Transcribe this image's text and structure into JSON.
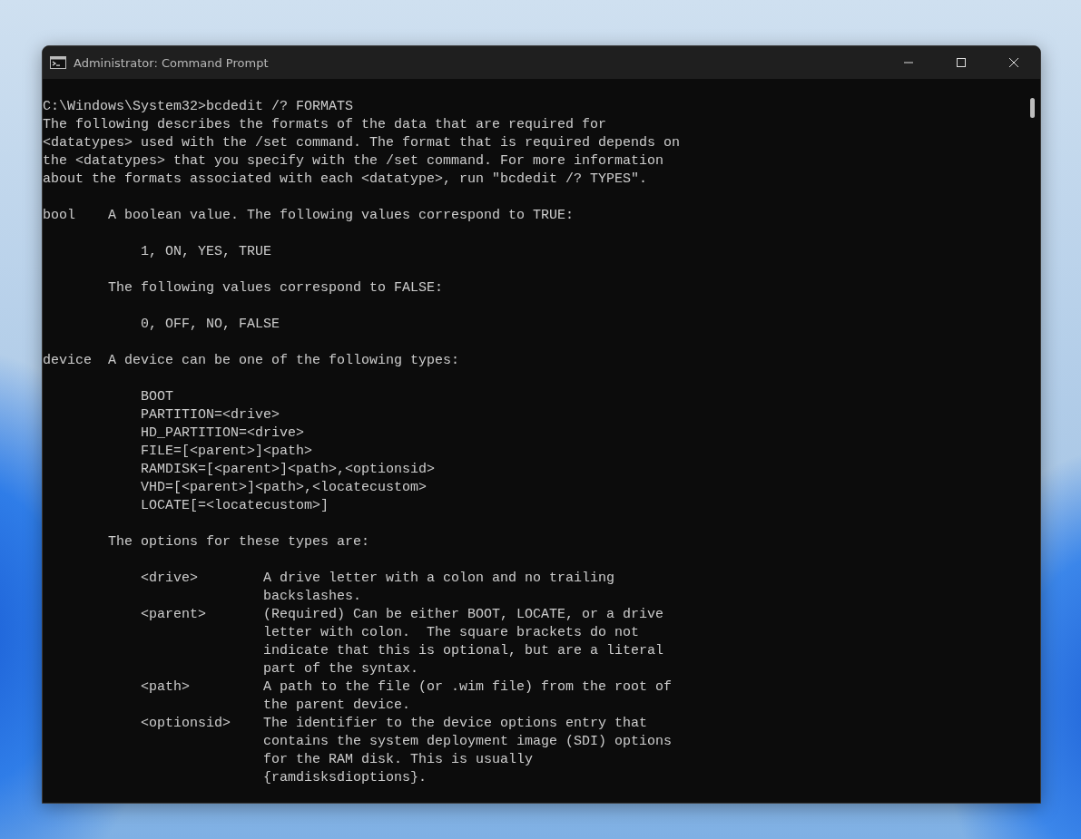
{
  "window": {
    "title": "Administrator: Command Prompt"
  },
  "terminal": {
    "rows": [
      {
        "kind": "line",
        "text": "C:\\Windows\\System32>bcdedit /? FORMATS"
      },
      {
        "kind": "line",
        "text": "The following describes the formats of the data that are required for"
      },
      {
        "kind": "line",
        "text": "<datatypes> used with the /set command. The format that is required depends on"
      },
      {
        "kind": "line",
        "text": "the <datatypes> that you specify with the /set command. For more information"
      },
      {
        "kind": "line",
        "text": "about the formats associated with each <datatype>, run \"bcdedit /? TYPES\"."
      },
      {
        "kind": "blank"
      },
      {
        "kind": "term",
        "term": "bool",
        "text": "A boolean value. The following values correspond to TRUE:"
      },
      {
        "kind": "blank"
      },
      {
        "kind": "item",
        "text": "1, ON, YES, TRUE"
      },
      {
        "kind": "blank"
      },
      {
        "kind": "indent",
        "text": "The following values correspond to FALSE:"
      },
      {
        "kind": "blank"
      },
      {
        "kind": "item",
        "text": "0, OFF, NO, FALSE"
      },
      {
        "kind": "blank"
      },
      {
        "kind": "term",
        "term": "device",
        "text": "A device can be one of the following types:"
      },
      {
        "kind": "blank"
      },
      {
        "kind": "item",
        "text": "BOOT"
      },
      {
        "kind": "item",
        "text": "PARTITION=<drive>"
      },
      {
        "kind": "item",
        "text": "HD_PARTITION=<drive>"
      },
      {
        "kind": "item",
        "text": "FILE=[<parent>]<path>"
      },
      {
        "kind": "item",
        "text": "RAMDISK=[<parent>]<path>,<optionsid>"
      },
      {
        "kind": "item",
        "text": "VHD=[<parent>]<path>,<locatecustom>"
      },
      {
        "kind": "item",
        "text": "LOCATE[=<locatecustom>]"
      },
      {
        "kind": "blank"
      },
      {
        "kind": "indent",
        "text": "The options for these types are:"
      },
      {
        "kind": "blank"
      },
      {
        "kind": "option",
        "term": "<drive>",
        "text": "A drive letter with a colon and no trailing"
      },
      {
        "kind": "cont",
        "text": "backslashes."
      },
      {
        "kind": "option",
        "term": "<parent>",
        "text": "(Required) Can be either BOOT, LOCATE, or a drive"
      },
      {
        "kind": "cont",
        "text": "letter with colon.  The square brackets do not"
      },
      {
        "kind": "cont",
        "text": "indicate that this is optional, but are a literal"
      },
      {
        "kind": "cont",
        "text": "part of the syntax."
      },
      {
        "kind": "option",
        "term": "<path>",
        "text": "A path to the file (or .wim file) from the root of"
      },
      {
        "kind": "cont",
        "text": "the parent device."
      },
      {
        "kind": "option",
        "term": "<optionsid>",
        "text": "The identifier to the device options entry that"
      },
      {
        "kind": "cont",
        "text": "contains the system deployment image (SDI) options"
      },
      {
        "kind": "cont",
        "text": "for the RAM disk. This is usually"
      },
      {
        "kind": "cont",
        "text": "{ramdisksdioptions}."
      }
    ]
  }
}
